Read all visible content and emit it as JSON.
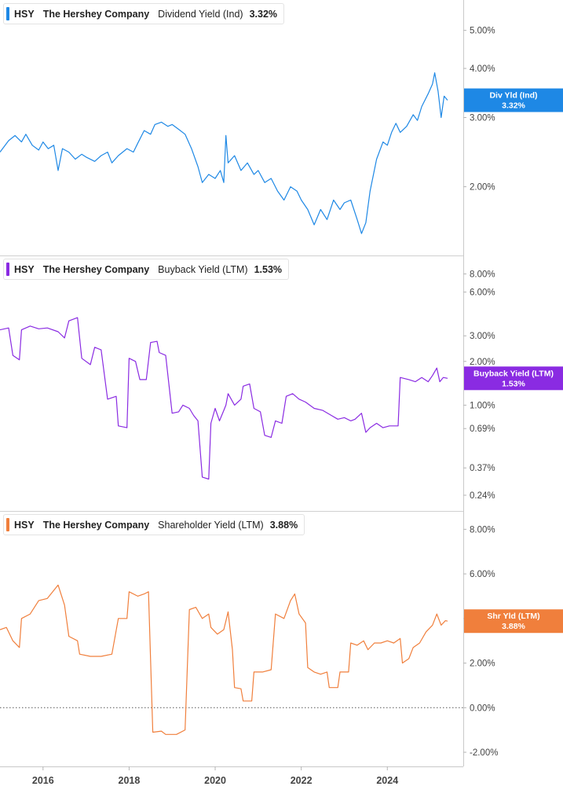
{
  "panels": [
    {
      "ticker": "HSY",
      "company": "The Hershey Company",
      "metric": "Dividend Yield (Ind)",
      "value": "3.32%",
      "color": "#1e88e5"
    },
    {
      "ticker": "HSY",
      "company": "The Hershey Company",
      "metric": "Buyback Yield (LTM)",
      "value": "1.53%",
      "color": "#8a2be2"
    },
    {
      "ticker": "HSY",
      "company": "The Hershey Company",
      "metric": "Shareholder Yield (LTM)",
      "value": "3.88%",
      "color": "#f07f3c"
    }
  ],
  "chart_data": [
    {
      "type": "line",
      "scale": "log",
      "ylim": [
        "1.40%",
        "5.60%"
      ],
      "y_ticks": [
        "5.00%",
        "4.00%",
        "3.00%",
        "2.00%"
      ],
      "x_ticks": [
        "2016",
        "2018",
        "2020",
        "2022",
        "2024"
      ],
      "flag": {
        "label": "Div Yld (Ind)",
        "value": "3.32%"
      },
      "color": "#1e88e5",
      "series": [
        {
          "values": [
            [
              2015.0,
              2.45
            ],
            [
              2015.2,
              2.62
            ],
            [
              2015.35,
              2.7
            ],
            [
              2015.5,
              2.6
            ],
            [
              2015.6,
              2.72
            ],
            [
              2015.75,
              2.55
            ],
            [
              2015.9,
              2.48
            ],
            [
              2016.0,
              2.6
            ],
            [
              2016.12,
              2.5
            ],
            [
              2016.25,
              2.55
            ],
            [
              2016.35,
              2.2
            ],
            [
              2016.45,
              2.5
            ],
            [
              2016.6,
              2.45
            ],
            [
              2016.75,
              2.35
            ],
            [
              2016.9,
              2.42
            ],
            [
              2017.0,
              2.38
            ],
            [
              2017.2,
              2.32
            ],
            [
              2017.35,
              2.4
            ],
            [
              2017.5,
              2.45
            ],
            [
              2017.6,
              2.3
            ],
            [
              2017.75,
              2.4
            ],
            [
              2017.95,
              2.5
            ],
            [
              2018.1,
              2.45
            ],
            [
              2018.2,
              2.58
            ],
            [
              2018.35,
              2.78
            ],
            [
              2018.5,
              2.72
            ],
            [
              2018.6,
              2.88
            ],
            [
              2018.75,
              2.92
            ],
            [
              2018.9,
              2.85
            ],
            [
              2019.0,
              2.88
            ],
            [
              2019.15,
              2.8
            ],
            [
              2019.3,
              2.72
            ],
            [
              2019.45,
              2.5
            ],
            [
              2019.6,
              2.25
            ],
            [
              2019.7,
              2.05
            ],
            [
              2019.85,
              2.15
            ],
            [
              2020.0,
              2.1
            ],
            [
              2020.12,
              2.2
            ],
            [
              2020.2,
              2.05
            ],
            [
              2020.25,
              2.7
            ],
            [
              2020.3,
              2.3
            ],
            [
              2020.45,
              2.4
            ],
            [
              2020.6,
              2.2
            ],
            [
              2020.75,
              2.3
            ],
            [
              2020.9,
              2.15
            ],
            [
              2021.0,
              2.2
            ],
            [
              2021.15,
              2.05
            ],
            [
              2021.3,
              2.1
            ],
            [
              2021.45,
              1.95
            ],
            [
              2021.6,
              1.85
            ],
            [
              2021.75,
              2.0
            ],
            [
              2021.9,
              1.95
            ],
            [
              2022.0,
              1.85
            ],
            [
              2022.15,
              1.75
            ],
            [
              2022.3,
              1.6
            ],
            [
              2022.45,
              1.75
            ],
            [
              2022.6,
              1.65
            ],
            [
              2022.75,
              1.85
            ],
            [
              2022.9,
              1.75
            ],
            [
              2023.0,
              1.82
            ],
            [
              2023.15,
              1.85
            ],
            [
              2023.3,
              1.65
            ],
            [
              2023.4,
              1.52
            ],
            [
              2023.5,
              1.62
            ],
            [
              2023.6,
              1.95
            ],
            [
              2023.75,
              2.35
            ],
            [
              2023.9,
              2.6
            ],
            [
              2024.0,
              2.55
            ],
            [
              2024.1,
              2.75
            ],
            [
              2024.2,
              2.9
            ],
            [
              2024.3,
              2.75
            ],
            [
              2024.45,
              2.85
            ],
            [
              2024.6,
              3.05
            ],
            [
              2024.7,
              2.95
            ],
            [
              2024.8,
              3.2
            ],
            [
              2024.95,
              3.45
            ],
            [
              2025.05,
              3.65
            ],
            [
              2025.1,
              3.9
            ],
            [
              2025.18,
              3.5
            ],
            [
              2025.25,
              3.0
            ],
            [
              2025.32,
              3.4
            ],
            [
              2025.4,
              3.32
            ]
          ]
        }
      ]
    },
    {
      "type": "line",
      "scale": "log",
      "ylim": [
        "0.24%",
        "9.00%"
      ],
      "y_ticks": [
        "8.00%",
        "6.00%",
        "3.00%",
        "2.00%",
        "1.00%",
        "0.69%",
        "0.37%",
        "0.24%"
      ],
      "x_ticks": [
        "2016",
        "2018",
        "2020",
        "2022",
        "2024"
      ],
      "flag": {
        "label": "Buyback Yield (LTM)",
        "value": "1.53%"
      },
      "color": "#8a2be2",
      "series": [
        {
          "values": [
            [
              2015.0,
              3.3
            ],
            [
              2015.2,
              3.4
            ],
            [
              2015.3,
              2.2
            ],
            [
              2015.45,
              2.05
            ],
            [
              2015.5,
              3.3
            ],
            [
              2015.7,
              3.5
            ],
            [
              2015.9,
              3.35
            ],
            [
              2016.1,
              3.4
            ],
            [
              2016.35,
              3.2
            ],
            [
              2016.5,
              2.9
            ],
            [
              2016.6,
              3.8
            ],
            [
              2016.8,
              4.0
            ],
            [
              2016.9,
              2.1
            ],
            [
              2017.1,
              1.9
            ],
            [
              2017.2,
              2.5
            ],
            [
              2017.35,
              2.4
            ],
            [
              2017.5,
              1.1
            ],
            [
              2017.7,
              1.15
            ],
            [
              2017.75,
              0.72
            ],
            [
              2017.95,
              0.7
            ],
            [
              2018.0,
              2.1
            ],
            [
              2018.15,
              2.0
            ],
            [
              2018.25,
              1.5
            ],
            [
              2018.4,
              1.5
            ],
            [
              2018.5,
              2.7
            ],
            [
              2018.65,
              2.75
            ],
            [
              2018.7,
              2.3
            ],
            [
              2018.85,
              2.2
            ],
            [
              2019.0,
              0.88
            ],
            [
              2019.15,
              0.9
            ],
            [
              2019.25,
              1.0
            ],
            [
              2019.4,
              0.95
            ],
            [
              2019.5,
              0.85
            ],
            [
              2019.6,
              0.78
            ],
            [
              2019.7,
              0.32
            ],
            [
              2019.85,
              0.31
            ],
            [
              2019.9,
              0.75
            ],
            [
              2020.0,
              0.95
            ],
            [
              2020.1,
              0.78
            ],
            [
              2020.2,
              0.92
            ],
            [
              2020.25,
              1.0
            ],
            [
              2020.3,
              1.2
            ],
            [
              2020.45,
              1.0
            ],
            [
              2020.6,
              1.1
            ],
            [
              2020.65,
              1.35
            ],
            [
              2020.8,
              1.4
            ],
            [
              2020.9,
              0.95
            ],
            [
              2021.05,
              0.9
            ],
            [
              2021.15,
              0.62
            ],
            [
              2021.3,
              0.6
            ],
            [
              2021.4,
              0.78
            ],
            [
              2021.55,
              0.75
            ],
            [
              2021.65,
              1.15
            ],
            [
              2021.8,
              1.2
            ],
            [
              2021.95,
              1.1
            ],
            [
              2022.1,
              1.05
            ],
            [
              2022.3,
              0.95
            ],
            [
              2022.5,
              0.92
            ],
            [
              2022.7,
              0.85
            ],
            [
              2022.85,
              0.8
            ],
            [
              2023.0,
              0.82
            ],
            [
              2023.15,
              0.78
            ],
            [
              2023.25,
              0.8
            ],
            [
              2023.4,
              0.88
            ],
            [
              2023.5,
              0.65
            ],
            [
              2023.6,
              0.7
            ],
            [
              2023.75,
              0.75
            ],
            [
              2023.9,
              0.7
            ],
            [
              2024.05,
              0.72
            ],
            [
              2024.25,
              0.72
            ],
            [
              2024.3,
              1.55
            ],
            [
              2024.5,
              1.5
            ],
            [
              2024.65,
              1.45
            ],
            [
              2024.8,
              1.55
            ],
            [
              2024.95,
              1.45
            ],
            [
              2025.05,
              1.6
            ],
            [
              2025.15,
              1.8
            ],
            [
              2025.22,
              1.45
            ],
            [
              2025.3,
              1.55
            ],
            [
              2025.4,
              1.53
            ]
          ]
        }
      ]
    },
    {
      "type": "line",
      "scale": "linear",
      "ylim": [
        -2.0,
        8.4
      ],
      "y_ticks": [
        "8.00%",
        "6.00%",
        "4.00%",
        "2.00%",
        "0.00%",
        "-2.00%"
      ],
      "x_ticks": [
        "2016",
        "2018",
        "2020",
        "2022",
        "2024"
      ],
      "flag": {
        "label": "Shr Yld (LTM)",
        "value": "3.88%"
      },
      "color": "#f07f3c",
      "series": [
        {
          "values": [
            [
              2015.0,
              3.5
            ],
            [
              2015.15,
              3.6
            ],
            [
              2015.3,
              3.0
            ],
            [
              2015.45,
              2.7
            ],
            [
              2015.5,
              4.0
            ],
            [
              2015.7,
              4.2
            ],
            [
              2015.9,
              4.8
            ],
            [
              2016.1,
              4.9
            ],
            [
              2016.35,
              5.5
            ],
            [
              2016.5,
              4.6
            ],
            [
              2016.6,
              3.2
            ],
            [
              2016.8,
              3.0
            ],
            [
              2016.85,
              2.4
            ],
            [
              2017.1,
              2.3
            ],
            [
              2017.35,
              2.3
            ],
            [
              2017.6,
              2.4
            ],
            [
              2017.75,
              4.0
            ],
            [
              2017.95,
              4.0
            ],
            [
              2018.0,
              5.2
            ],
            [
              2018.2,
              5.0
            ],
            [
              2018.35,
              5.1
            ],
            [
              2018.45,
              5.2
            ],
            [
              2018.55,
              -1.1
            ],
            [
              2018.75,
              -1.05
            ],
            [
              2018.85,
              -1.2
            ],
            [
              2019.1,
              -1.2
            ],
            [
              2019.3,
              -1.0
            ],
            [
              2019.4,
              4.4
            ],
            [
              2019.55,
              4.5
            ],
            [
              2019.7,
              4.0
            ],
            [
              2019.85,
              4.2
            ],
            [
              2019.9,
              3.6
            ],
            [
              2020.05,
              3.3
            ],
            [
              2020.2,
              3.5
            ],
            [
              2020.3,
              4.3
            ],
            [
              2020.4,
              2.6
            ],
            [
              2020.45,
              0.9
            ],
            [
              2020.6,
              0.85
            ],
            [
              2020.65,
              0.3
            ],
            [
              2020.85,
              0.3
            ],
            [
              2020.9,
              1.6
            ],
            [
              2021.1,
              1.6
            ],
            [
              2021.3,
              1.7
            ],
            [
              2021.4,
              4.2
            ],
            [
              2021.6,
              4.0
            ],
            [
              2021.75,
              4.8
            ],
            [
              2021.85,
              5.1
            ],
            [
              2021.95,
              4.2
            ],
            [
              2022.1,
              3.8
            ],
            [
              2022.15,
              1.8
            ],
            [
              2022.3,
              1.6
            ],
            [
              2022.45,
              1.5
            ],
            [
              2022.6,
              1.6
            ],
            [
              2022.65,
              0.9
            ],
            [
              2022.85,
              0.9
            ],
            [
              2022.9,
              1.6
            ],
            [
              2023.1,
              1.6
            ],
            [
              2023.15,
              2.9
            ],
            [
              2023.3,
              2.8
            ],
            [
              2023.45,
              3.0
            ],
            [
              2023.55,
              2.6
            ],
            [
              2023.7,
              2.9
            ],
            [
              2023.85,
              2.9
            ],
            [
              2024.0,
              3.0
            ],
            [
              2024.15,
              2.9
            ],
            [
              2024.3,
              3.1
            ],
            [
              2024.35,
              2.0
            ],
            [
              2024.5,
              2.2
            ],
            [
              2024.6,
              2.7
            ],
            [
              2024.75,
              2.9
            ],
            [
              2024.9,
              3.4
            ],
            [
              2025.05,
              3.7
            ],
            [
              2025.15,
              4.2
            ],
            [
              2025.25,
              3.7
            ],
            [
              2025.35,
              3.9
            ],
            [
              2025.4,
              3.88
            ]
          ]
        }
      ]
    }
  ]
}
